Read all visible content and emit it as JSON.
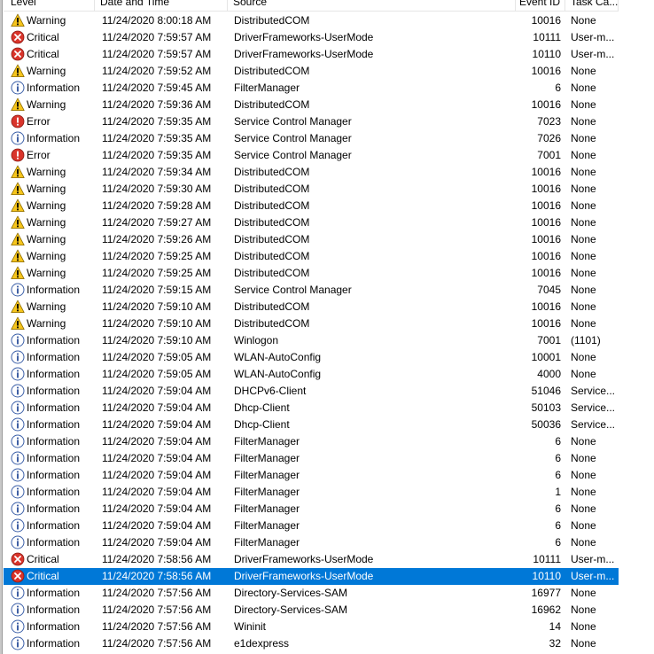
{
  "columns": {
    "level": "Level",
    "date": "Date and Time",
    "source": "Source",
    "event_id": "Event ID",
    "task": "Task Ca..."
  },
  "colors": {
    "selection": "#0078d7",
    "warning": "#f6c51c",
    "critical": "#d9342b",
    "error": "#d9342b",
    "information": "#ffffff"
  },
  "rows": [
    {
      "level": "Warning",
      "icon": "warning-icon",
      "date": "11/24/2020 8:00:18 AM",
      "source": "DistributedCOM",
      "event_id": "10016",
      "task": "None"
    },
    {
      "level": "Critical",
      "icon": "critical-icon",
      "date": "11/24/2020 7:59:57 AM",
      "source": "DriverFrameworks-UserMode",
      "event_id": "10111",
      "task": "User-m..."
    },
    {
      "level": "Critical",
      "icon": "critical-icon",
      "date": "11/24/2020 7:59:57 AM",
      "source": "DriverFrameworks-UserMode",
      "event_id": "10110",
      "task": "User-m..."
    },
    {
      "level": "Warning",
      "icon": "warning-icon",
      "date": "11/24/2020 7:59:52 AM",
      "source": "DistributedCOM",
      "event_id": "10016",
      "task": "None"
    },
    {
      "level": "Information",
      "icon": "information-icon",
      "date": "11/24/2020 7:59:45 AM",
      "source": "FilterManager",
      "event_id": "6",
      "task": "None"
    },
    {
      "level": "Warning",
      "icon": "warning-icon",
      "date": "11/24/2020 7:59:36 AM",
      "source": "DistributedCOM",
      "event_id": "10016",
      "task": "None"
    },
    {
      "level": "Error",
      "icon": "error-icon",
      "date": "11/24/2020 7:59:35 AM",
      "source": "Service Control Manager",
      "event_id": "7023",
      "task": "None"
    },
    {
      "level": "Information",
      "icon": "information-icon",
      "date": "11/24/2020 7:59:35 AM",
      "source": "Service Control Manager",
      "event_id": "7026",
      "task": "None"
    },
    {
      "level": "Error",
      "icon": "error-icon",
      "date": "11/24/2020 7:59:35 AM",
      "source": "Service Control Manager",
      "event_id": "7001",
      "task": "None"
    },
    {
      "level": "Warning",
      "icon": "warning-icon",
      "date": "11/24/2020 7:59:34 AM",
      "source": "DistributedCOM",
      "event_id": "10016",
      "task": "None"
    },
    {
      "level": "Warning",
      "icon": "warning-icon",
      "date": "11/24/2020 7:59:30 AM",
      "source": "DistributedCOM",
      "event_id": "10016",
      "task": "None"
    },
    {
      "level": "Warning",
      "icon": "warning-icon",
      "date": "11/24/2020 7:59:28 AM",
      "source": "DistributedCOM",
      "event_id": "10016",
      "task": "None"
    },
    {
      "level": "Warning",
      "icon": "warning-icon",
      "date": "11/24/2020 7:59:27 AM",
      "source": "DistributedCOM",
      "event_id": "10016",
      "task": "None"
    },
    {
      "level": "Warning",
      "icon": "warning-icon",
      "date": "11/24/2020 7:59:26 AM",
      "source": "DistributedCOM",
      "event_id": "10016",
      "task": "None"
    },
    {
      "level": "Warning",
      "icon": "warning-icon",
      "date": "11/24/2020 7:59:25 AM",
      "source": "DistributedCOM",
      "event_id": "10016",
      "task": "None"
    },
    {
      "level": "Warning",
      "icon": "warning-icon",
      "date": "11/24/2020 7:59:25 AM",
      "source": "DistributedCOM",
      "event_id": "10016",
      "task": "None"
    },
    {
      "level": "Information",
      "icon": "information-icon",
      "date": "11/24/2020 7:59:15 AM",
      "source": "Service Control Manager",
      "event_id": "7045",
      "task": "None"
    },
    {
      "level": "Warning",
      "icon": "warning-icon",
      "date": "11/24/2020 7:59:10 AM",
      "source": "DistributedCOM",
      "event_id": "10016",
      "task": "None"
    },
    {
      "level": "Warning",
      "icon": "warning-icon",
      "date": "11/24/2020 7:59:10 AM",
      "source": "DistributedCOM",
      "event_id": "10016",
      "task": "None"
    },
    {
      "level": "Information",
      "icon": "information-icon",
      "date": "11/24/2020 7:59:10 AM",
      "source": "Winlogon",
      "event_id": "7001",
      "task": "(1101)"
    },
    {
      "level": "Information",
      "icon": "information-icon",
      "date": "11/24/2020 7:59:05 AM",
      "source": "WLAN-AutoConfig",
      "event_id": "10001",
      "task": "None"
    },
    {
      "level": "Information",
      "icon": "information-icon",
      "date": "11/24/2020 7:59:05 AM",
      "source": "WLAN-AutoConfig",
      "event_id": "4000",
      "task": "None"
    },
    {
      "level": "Information",
      "icon": "information-icon",
      "date": "11/24/2020 7:59:04 AM",
      "source": "DHCPv6-Client",
      "event_id": "51046",
      "task": "Service..."
    },
    {
      "level": "Information",
      "icon": "information-icon",
      "date": "11/24/2020 7:59:04 AM",
      "source": "Dhcp-Client",
      "event_id": "50103",
      "task": "Service..."
    },
    {
      "level": "Information",
      "icon": "information-icon",
      "date": "11/24/2020 7:59:04 AM",
      "source": "Dhcp-Client",
      "event_id": "50036",
      "task": "Service..."
    },
    {
      "level": "Information",
      "icon": "information-icon",
      "date": "11/24/2020 7:59:04 AM",
      "source": "FilterManager",
      "event_id": "6",
      "task": "None"
    },
    {
      "level": "Information",
      "icon": "information-icon",
      "date": "11/24/2020 7:59:04 AM",
      "source": "FilterManager",
      "event_id": "6",
      "task": "None"
    },
    {
      "level": "Information",
      "icon": "information-icon",
      "date": "11/24/2020 7:59:04 AM",
      "source": "FilterManager",
      "event_id": "6",
      "task": "None"
    },
    {
      "level": "Information",
      "icon": "information-icon",
      "date": "11/24/2020 7:59:04 AM",
      "source": "FilterManager",
      "event_id": "1",
      "task": "None"
    },
    {
      "level": "Information",
      "icon": "information-icon",
      "date": "11/24/2020 7:59:04 AM",
      "source": "FilterManager",
      "event_id": "6",
      "task": "None"
    },
    {
      "level": "Information",
      "icon": "information-icon",
      "date": "11/24/2020 7:59:04 AM",
      "source": "FilterManager",
      "event_id": "6",
      "task": "None"
    },
    {
      "level": "Information",
      "icon": "information-icon",
      "date": "11/24/2020 7:59:04 AM",
      "source": "FilterManager",
      "event_id": "6",
      "task": "None"
    },
    {
      "level": "Critical",
      "icon": "critical-icon",
      "date": "11/24/2020 7:58:56 AM",
      "source": "DriverFrameworks-UserMode",
      "event_id": "10111",
      "task": "User-m..."
    },
    {
      "level": "Critical",
      "icon": "critical-icon",
      "date": "11/24/2020 7:58:56 AM",
      "source": "DriverFrameworks-UserMode",
      "event_id": "10110",
      "task": "User-m...",
      "selected": true
    },
    {
      "level": "Information",
      "icon": "information-icon",
      "date": "11/24/2020 7:57:56 AM",
      "source": "Directory-Services-SAM",
      "event_id": "16977",
      "task": "None"
    },
    {
      "level": "Information",
      "icon": "information-icon",
      "date": "11/24/2020 7:57:56 AM",
      "source": "Directory-Services-SAM",
      "event_id": "16962",
      "task": "None"
    },
    {
      "level": "Information",
      "icon": "information-icon",
      "date": "11/24/2020 7:57:56 AM",
      "source": "Wininit",
      "event_id": "14",
      "task": "None"
    },
    {
      "level": "Information",
      "icon": "information-icon",
      "date": "11/24/2020 7:57:56 AM",
      "source": "e1dexpress",
      "event_id": "32",
      "task": "None"
    }
  ]
}
